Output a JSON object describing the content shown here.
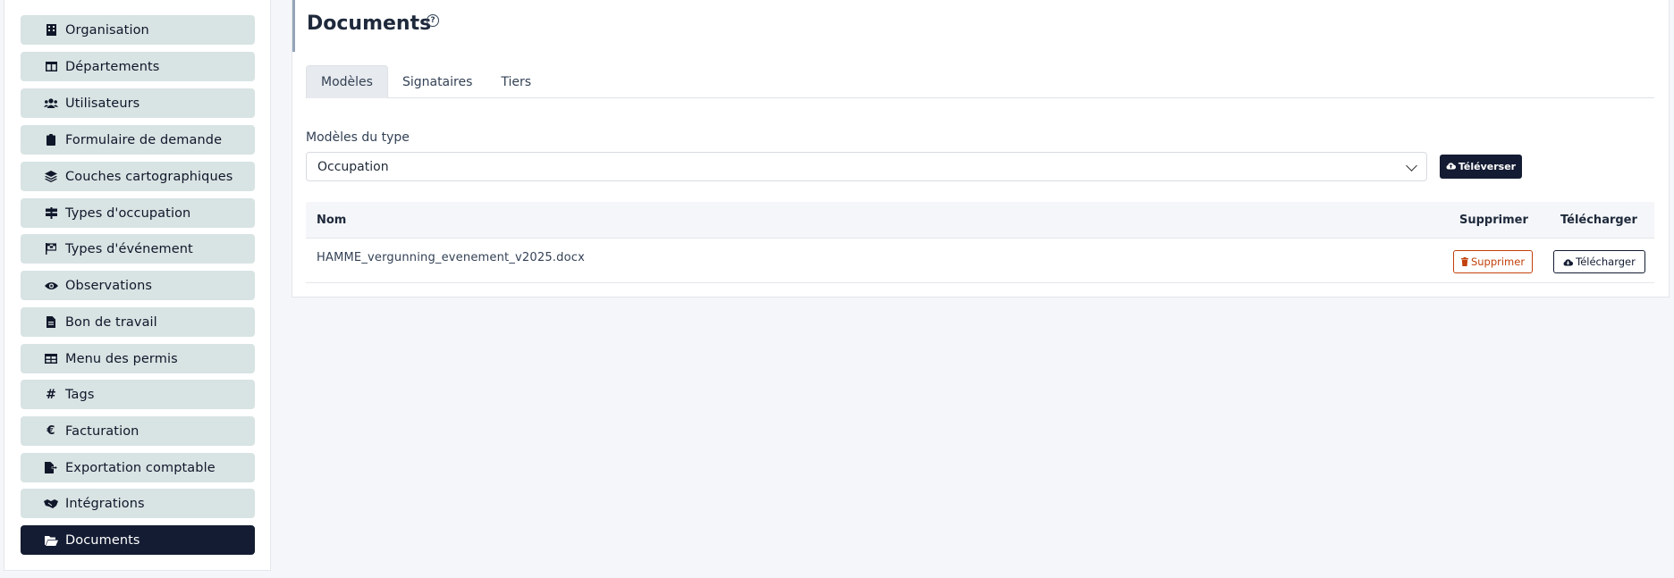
{
  "sidebar": {
    "items": [
      {
        "label": "Organisation",
        "icon": "building-icon",
        "glyph": "▮"
      },
      {
        "label": "Départements",
        "icon": "columns-icon",
        "glyph": "◫"
      },
      {
        "label": "Utilisateurs",
        "icon": "users-icon",
        "glyph": "👥"
      },
      {
        "label": "Formulaire de demande",
        "icon": "clipboard-icon",
        "glyph": "▮"
      },
      {
        "label": "Couches cartographiques",
        "icon": "layers-icon",
        "glyph": "◈"
      },
      {
        "label": "Types d'occupation",
        "icon": "signpost-icon",
        "glyph": "☰"
      },
      {
        "label": "Types d'événement",
        "icon": "flag-checkered-icon",
        "glyph": "⚑"
      },
      {
        "label": "Observations",
        "icon": "eye-icon",
        "glyph": "◉"
      },
      {
        "label": "Bon de travail",
        "icon": "file-icon",
        "glyph": "▤"
      },
      {
        "label": "Menu des permis",
        "icon": "table-icon",
        "glyph": "▦"
      },
      {
        "label": "Tags",
        "icon": "hashtag-icon",
        "glyph": "#"
      },
      {
        "label": "Facturation",
        "icon": "euro-icon",
        "glyph": "€"
      },
      {
        "label": "Exportation comptable",
        "icon": "file-export-icon",
        "glyph": "⇥"
      },
      {
        "label": "Intégrations",
        "icon": "handshake-icon",
        "glyph": "🤝"
      },
      {
        "label": "Documents",
        "icon": "folder-open-icon",
        "glyph": "📂"
      }
    ],
    "active_index": 14
  },
  "main": {
    "title": "Documents",
    "help_glyph": "?",
    "tabs": [
      {
        "label": "Modèles"
      },
      {
        "label": "Signataires"
      },
      {
        "label": "Tiers"
      }
    ],
    "type_label": "Modèles du type",
    "type_value": "Occupation",
    "upload_label": "Téléverser",
    "table": {
      "headers": {
        "name": "Nom",
        "delete": "Supprimer",
        "download": "Télécharger"
      },
      "rows": [
        {
          "name": "HAMME_vergunning_evenement_v2025.docx",
          "delete_label": "Supprimer",
          "download_label": "Télécharger"
        }
      ]
    }
  },
  "colors": {
    "sidebar_item_bg": "#d8e3e3",
    "active_bg": "#141c33",
    "danger": "#c2410c",
    "page_bg": "#f5f6f9"
  }
}
